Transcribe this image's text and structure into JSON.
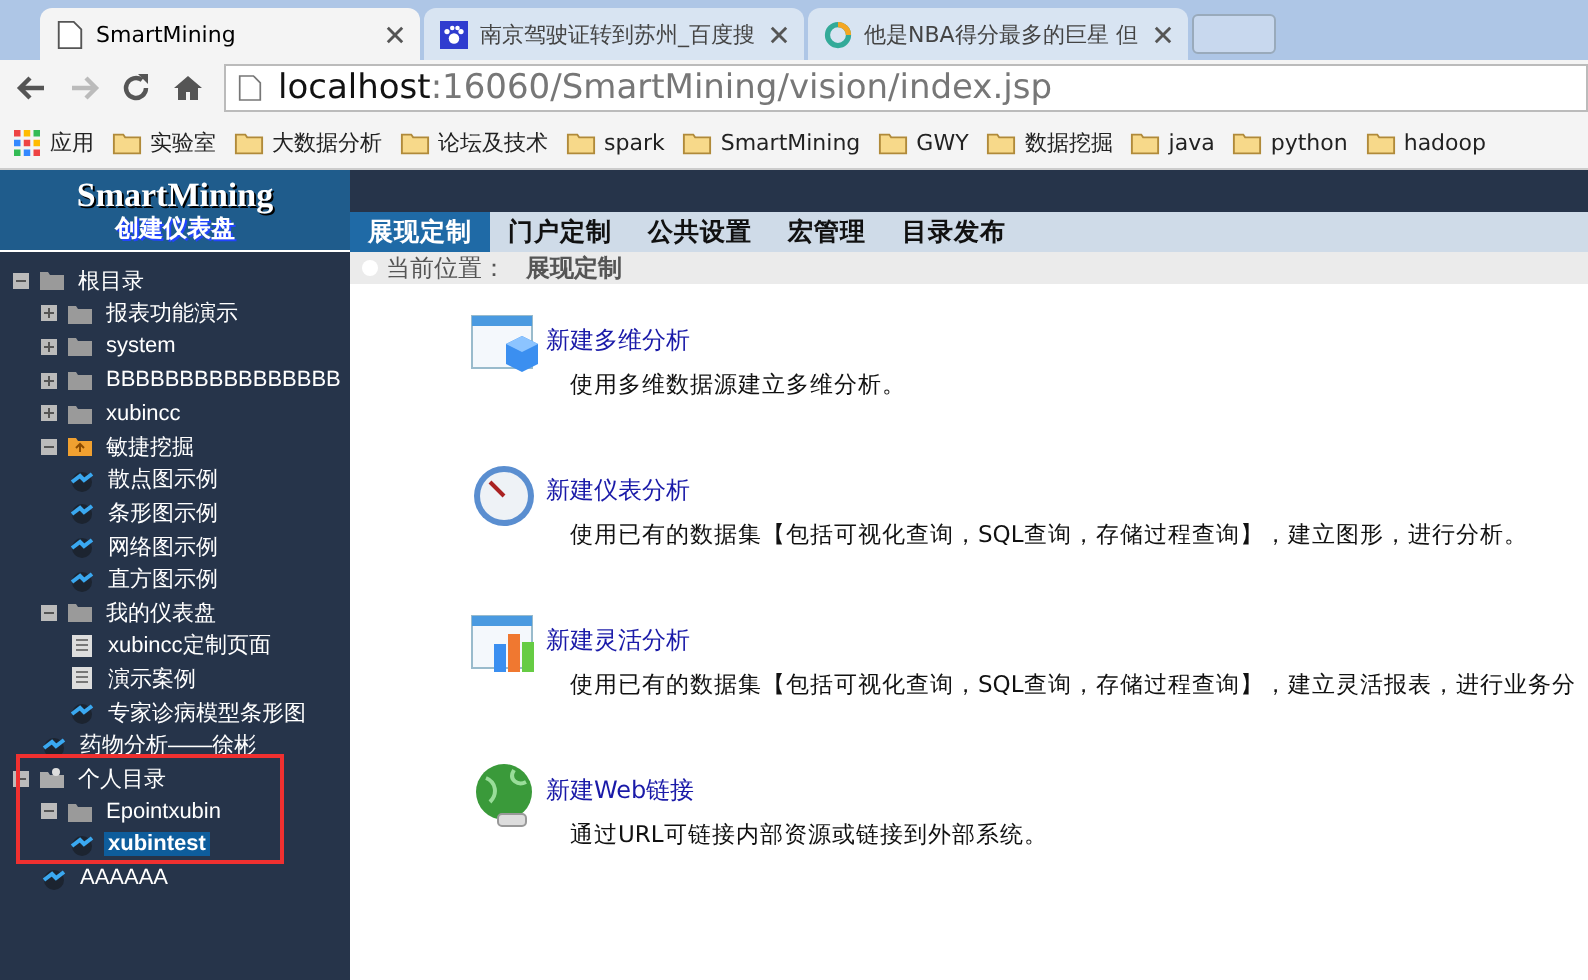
{
  "browser": {
    "tabs": [
      {
        "title": "SmartMining",
        "kind": "page",
        "selected": true
      },
      {
        "title": "南京驾驶证转到苏州_百度搜",
        "kind": "paw",
        "selected": false
      },
      {
        "title": "他是NBA得分最多的巨星 但",
        "kind": "ring",
        "selected": false
      }
    ],
    "url_host": "localhost",
    "url_path": ":16060/SmartMining/vision/index.jsp",
    "bookmarks": [
      {
        "label": "应用",
        "kind": "apps"
      },
      {
        "label": "实验室",
        "kind": "folder"
      },
      {
        "label": "大数据分析",
        "kind": "folder"
      },
      {
        "label": "论坛及技术",
        "kind": "folder"
      },
      {
        "label": "spark",
        "kind": "folder"
      },
      {
        "label": "SmartMining",
        "kind": "folder"
      },
      {
        "label": "GWY",
        "kind": "folder"
      },
      {
        "label": "数据挖掘",
        "kind": "folder"
      },
      {
        "label": "java",
        "kind": "folder"
      },
      {
        "label": "python",
        "kind": "folder"
      },
      {
        "label": "hadoop",
        "kind": "folder"
      }
    ]
  },
  "header": {
    "logo": "SmartMining",
    "subtitle": "创建仪表盘"
  },
  "nav_tabs": [
    {
      "label": "展现定制",
      "selected": true
    },
    {
      "label": "门户定制",
      "selected": false
    },
    {
      "label": "公共设置",
      "selected": false
    },
    {
      "label": "宏管理",
      "selected": false
    },
    {
      "label": "目录发布",
      "selected": false
    }
  ],
  "breadcrumb": {
    "label": "当前位置：",
    "current": "展现定制"
  },
  "tree": [
    {
      "label": "根目录",
      "kind": "folder",
      "expanded": true,
      "selected": false,
      "children": [
        {
          "label": "报表功能演示",
          "kind": "folder",
          "expanded": false,
          "selected": false
        },
        {
          "label": "system",
          "kind": "folder",
          "expanded": false,
          "selected": false
        },
        {
          "label": "BBBBBBBBBBBBBBBB",
          "kind": "folder",
          "expanded": false,
          "selected": false
        },
        {
          "label": "xubincc",
          "kind": "folder",
          "expanded": false,
          "selected": false
        },
        {
          "label": "敏捷挖掘",
          "kind": "special-folder",
          "expanded": true,
          "selected": false,
          "children": [
            {
              "label": "散点图示例",
              "kind": "chart",
              "selected": false
            },
            {
              "label": "条形图示例",
              "kind": "chart",
              "selected": false
            },
            {
              "label": "网络图示例",
              "kind": "chart",
              "selected": false
            },
            {
              "label": "直方图示例",
              "kind": "chart",
              "selected": false
            }
          ]
        },
        {
          "label": "我的仪表盘",
          "kind": "folder",
          "expanded": true,
          "selected": false,
          "children": [
            {
              "label": "xubincc定制页面",
              "kind": "page",
              "selected": false
            },
            {
              "label": "演示案例",
              "kind": "page",
              "selected": false
            },
            {
              "label": "专家诊病模型条形图",
              "kind": "chart",
              "selected": false
            }
          ]
        },
        {
          "label": "药物分析——徐彬",
          "kind": "chart",
          "selected": false
        }
      ]
    },
    {
      "label": "个人目录",
      "kind": "personal",
      "expanded": true,
      "selected": false,
      "children": [
        {
          "label": "Epointxubin",
          "kind": "folder",
          "expanded": true,
          "selected": false,
          "children": [
            {
              "label": "xubintest",
              "kind": "chart",
              "selected": true
            }
          ]
        },
        {
          "label": "AAAAAA",
          "kind": "chart",
          "selected": false
        }
      ]
    }
  ],
  "actions": [
    {
      "kind": "cube",
      "title": "新建多维分析",
      "description": "使用多维数据源建立多维分析。"
    },
    {
      "kind": "gauge",
      "title": "新建仪表分析",
      "description": "使用已有的数据集【包括可视化查询，SQL查询，存储过程查询】，建立图形，进行分析。"
    },
    {
      "kind": "bars",
      "title": "新建灵活分析",
      "description": "使用已有的数据集【包括可视化查询，SQL查询，存储过程查询】，建立灵活报表，进行业务分"
    },
    {
      "kind": "globe",
      "title": "新建Web链接",
      "description": "通过URL可链接内部资源或链接到外部系统。"
    }
  ]
}
